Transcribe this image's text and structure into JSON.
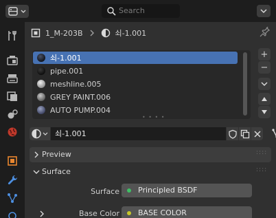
{
  "header": {
    "search_placeholder": "Search"
  },
  "breadcrumb": {
    "object_name": "1_M-203B",
    "material_name": "쇠-1.001"
  },
  "material_slots": [
    {
      "name": "쇠-1.001",
      "selected": true,
      "sphere_color": "#2a2f3a"
    },
    {
      "name": "pipe.001",
      "selected": false,
      "sphere_color": "#262626"
    },
    {
      "name": "meshline.005",
      "selected": false,
      "sphere_color": "#c8c8c8"
    },
    {
      "name": "GREY PAINT.006",
      "selected": false,
      "sphere_color": "#9a9a9a"
    },
    {
      "name": "AUTO PUMP.004",
      "selected": false,
      "sphere_color": "#6e7590"
    }
  ],
  "material": {
    "name": "쇠-1.001"
  },
  "panels": {
    "preview": "Preview",
    "surface": "Surface"
  },
  "surface_props": {
    "surface_label": "Surface",
    "surface_value": "Principled BSDF",
    "base_color_label": "Base Color",
    "base_color_value": "BASE COLOR"
  },
  "colors": {
    "accent": "#4772b3",
    "shader_socket": "#3fbf65",
    "color_socket": "#c7c729",
    "header_bg": "#1d1d1d",
    "panel_bg": "#303030",
    "material_tab": "#e06a2e"
  }
}
